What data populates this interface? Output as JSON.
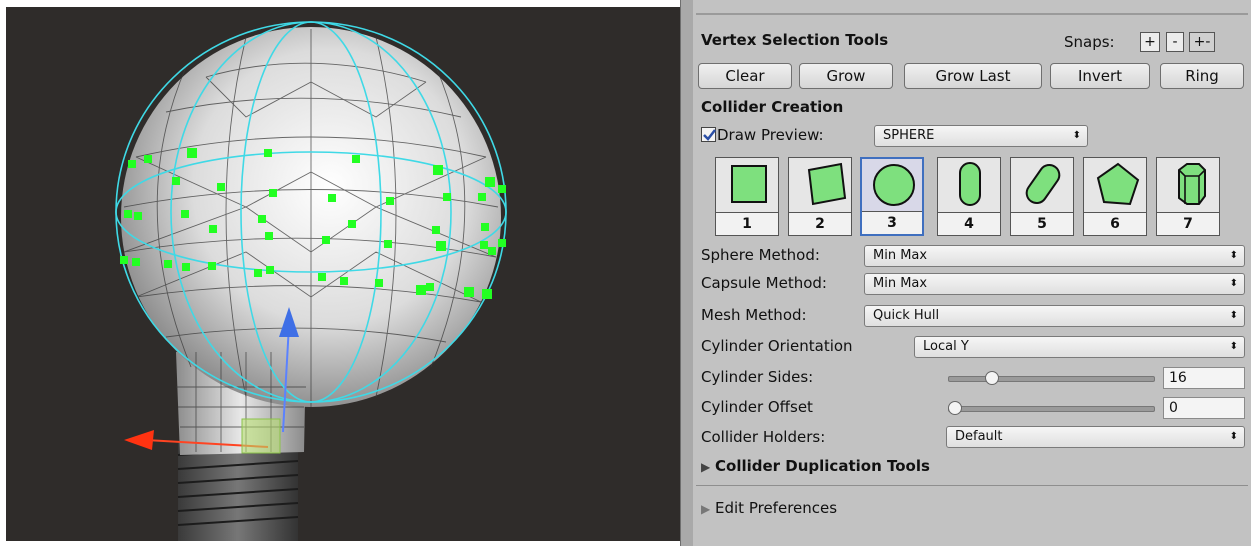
{
  "vertex_tools": {
    "title": "Vertex Selection Tools",
    "snaps_label": "Snaps:",
    "snap_buttons": [
      "+",
      "-",
      "+-"
    ],
    "buttons": [
      "Clear",
      "Grow",
      "Grow Last",
      "Invert",
      "Ring"
    ]
  },
  "collider_creation": {
    "title": "Collider Creation",
    "draw_preview_label": "Draw Preview:",
    "draw_preview_checked": true,
    "draw_preview_value": "SPHERE",
    "shapes": [
      {
        "num": "1",
        "icon": "box-collider-icon"
      },
      {
        "num": "2",
        "icon": "rotated-box-collider-icon"
      },
      {
        "num": "3",
        "icon": "sphere-collider-icon",
        "selected": true
      },
      {
        "num": "4",
        "icon": "capsule-collider-icon"
      },
      {
        "num": "5",
        "icon": "rotated-capsule-collider-icon"
      },
      {
        "num": "6",
        "icon": "convex-mesh-collider-icon"
      },
      {
        "num": "7",
        "icon": "cylinder-collider-icon"
      }
    ],
    "sphere_method_label": "Sphere Method:",
    "sphere_method_value": "Min Max",
    "capsule_method_label": "Capsule Method:",
    "capsule_method_value": "Min Max",
    "mesh_method_label": "Mesh Method:",
    "mesh_method_value": "Quick Hull",
    "cylinder_orientation_label": "Cylinder Orientation",
    "cylinder_orientation_value": "Local Y",
    "cylinder_sides_label": "Cylinder Sides:",
    "cylinder_sides_value": "16",
    "cylinder_offset_label": "Cylinder Offset",
    "cylinder_offset_value": "0",
    "collider_holders_label": "Collider Holders:",
    "collider_holders_value": "Default",
    "duplication_label": "Collider Duplication Tools"
  },
  "edit_preferences_label": "Edit Preferences",
  "colors": {
    "panel_bg": "#c2c2c2",
    "viewport_bg": "#2f2c2a",
    "selection_green": "#22ff22",
    "collider_cyan": "#3fd9e6",
    "selected_shape_border": "#3f6fbf"
  }
}
